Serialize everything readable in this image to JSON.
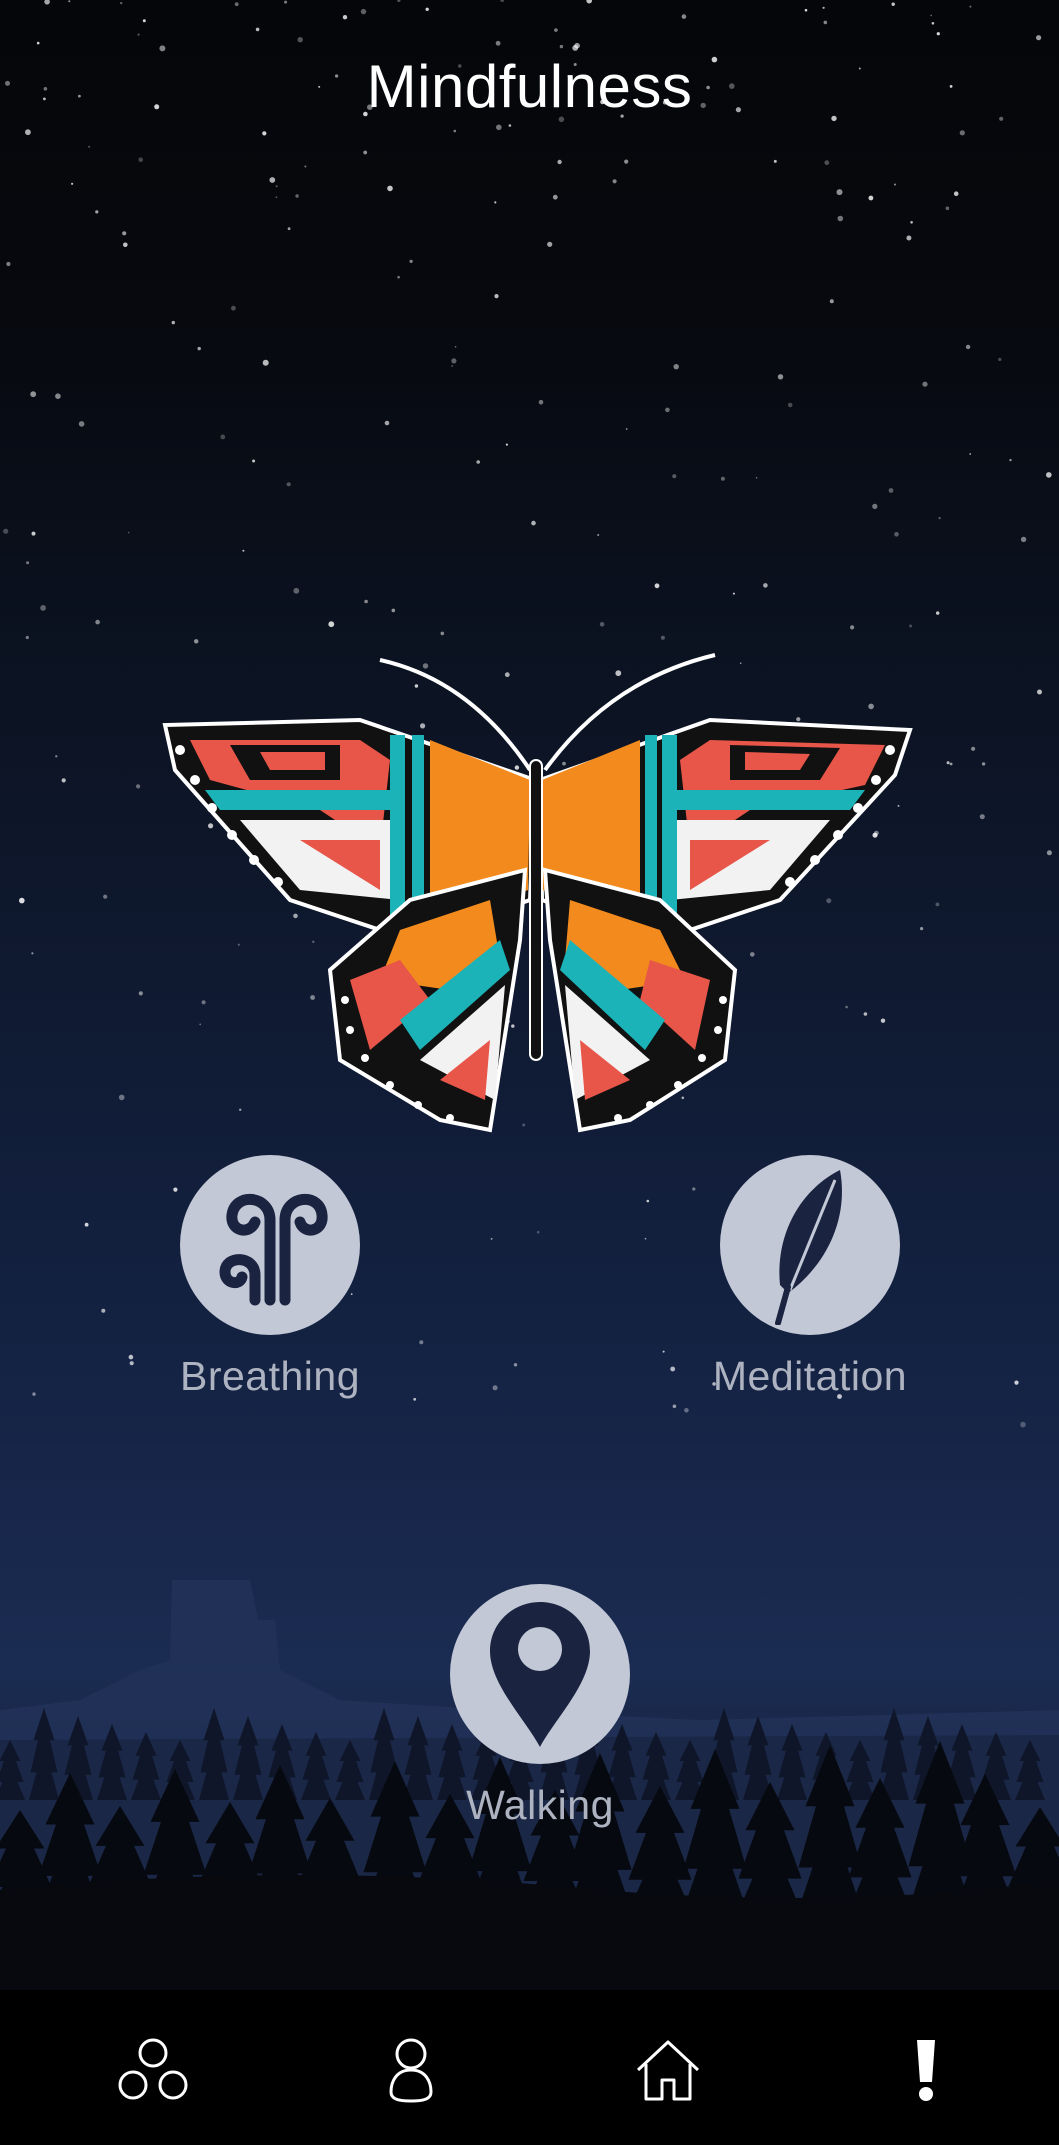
{
  "header": {
    "title": "Mindfulness"
  },
  "activities": [
    {
      "label": "Breathing",
      "icon": "wind-swirl-icon"
    },
    {
      "label": "Meditation",
      "icon": "feather-icon"
    },
    {
      "label": "Walking",
      "icon": "map-pin-icon"
    }
  ],
  "tabbar": {
    "items": [
      {
        "icon": "community-icon"
      },
      {
        "icon": "profile-icon"
      },
      {
        "icon": "home-icon"
      },
      {
        "icon": "exclamation-icon"
      }
    ]
  },
  "colors": {
    "icon_circle": "#c3c8d6",
    "icon_glyph": "#1a2440",
    "label": "#aeb3c1",
    "butterfly_red": "#e8564a",
    "butterfly_orange": "#f28a1e",
    "butterfly_teal": "#1bb3b8"
  }
}
